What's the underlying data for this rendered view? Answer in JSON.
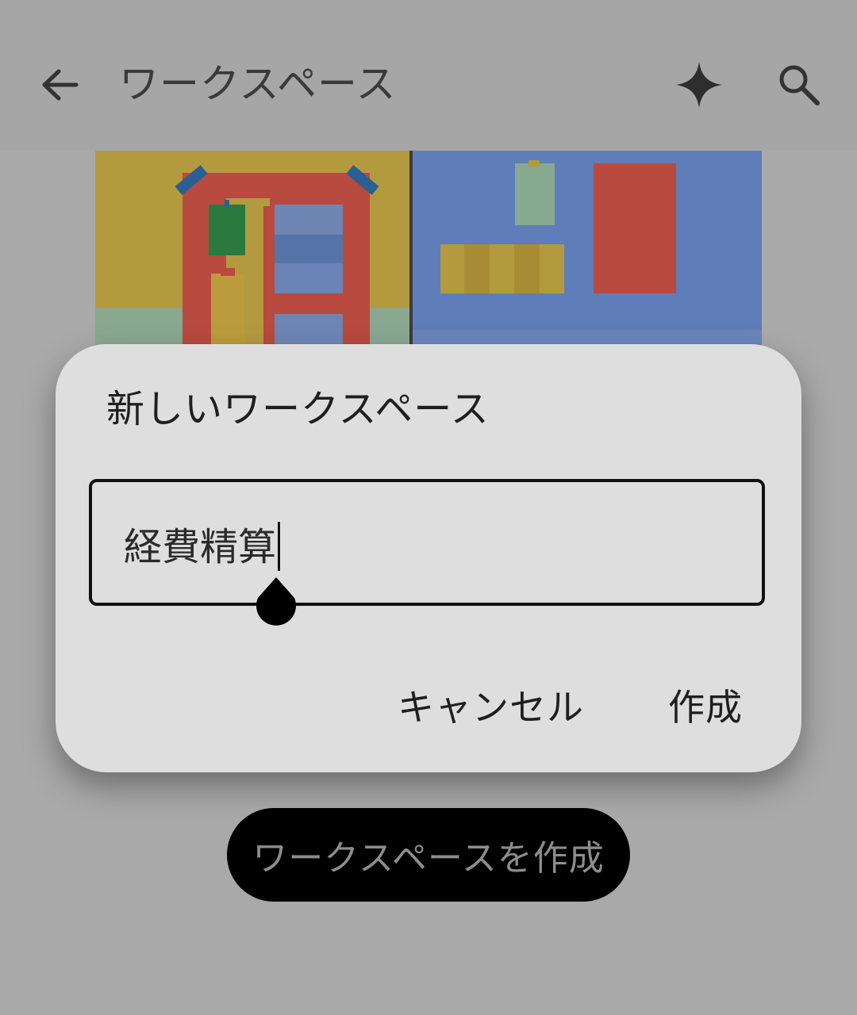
{
  "appbar": {
    "title": "ワークスペース",
    "back_icon": "arrow-back-icon",
    "sparkle_icon": "sparkle-icon",
    "search_icon": "search-icon"
  },
  "dialog": {
    "title": "新しいワークスペース",
    "field_value": "経費精算",
    "cancel_label": "キャンセル",
    "create_label": "作成"
  },
  "create_workspace_button": "ワークスペースを作成",
  "colors": {
    "scrim_bg": "#a9a9a9",
    "dialog_bg": "#dedede",
    "pill_bg": "#000000"
  }
}
